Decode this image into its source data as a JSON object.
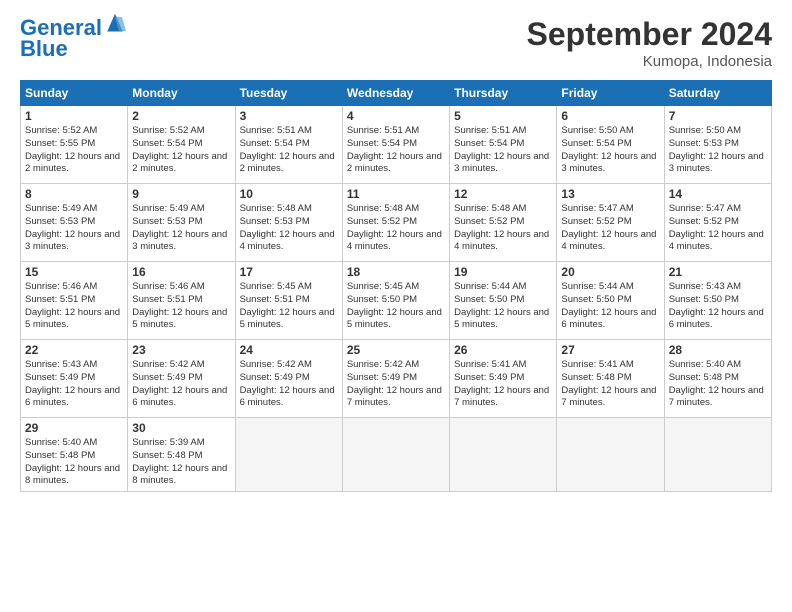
{
  "logo": {
    "line1": "General",
    "line2": "Blue"
  },
  "header": {
    "title": "September 2024",
    "subtitle": "Kumopa, Indonesia"
  },
  "days_of_week": [
    "Sunday",
    "Monday",
    "Tuesday",
    "Wednesday",
    "Thursday",
    "Friday",
    "Saturday"
  ],
  "weeks": [
    [
      {
        "day": "1",
        "sunrise": "5:52 AM",
        "sunset": "5:55 PM",
        "daylight": "12 hours and 2 minutes."
      },
      {
        "day": "2",
        "sunrise": "5:52 AM",
        "sunset": "5:54 PM",
        "daylight": "12 hours and 2 minutes."
      },
      {
        "day": "3",
        "sunrise": "5:51 AM",
        "sunset": "5:54 PM",
        "daylight": "12 hours and 2 minutes."
      },
      {
        "day": "4",
        "sunrise": "5:51 AM",
        "sunset": "5:54 PM",
        "daylight": "12 hours and 2 minutes."
      },
      {
        "day": "5",
        "sunrise": "5:51 AM",
        "sunset": "5:54 PM",
        "daylight": "12 hours and 3 minutes."
      },
      {
        "day": "6",
        "sunrise": "5:50 AM",
        "sunset": "5:54 PM",
        "daylight": "12 hours and 3 minutes."
      },
      {
        "day": "7",
        "sunrise": "5:50 AM",
        "sunset": "5:53 PM",
        "daylight": "12 hours and 3 minutes."
      }
    ],
    [
      {
        "day": "8",
        "sunrise": "5:49 AM",
        "sunset": "5:53 PM",
        "daylight": "12 hours and 3 minutes."
      },
      {
        "day": "9",
        "sunrise": "5:49 AM",
        "sunset": "5:53 PM",
        "daylight": "12 hours and 3 minutes."
      },
      {
        "day": "10",
        "sunrise": "5:48 AM",
        "sunset": "5:53 PM",
        "daylight": "12 hours and 4 minutes."
      },
      {
        "day": "11",
        "sunrise": "5:48 AM",
        "sunset": "5:52 PM",
        "daylight": "12 hours and 4 minutes."
      },
      {
        "day": "12",
        "sunrise": "5:48 AM",
        "sunset": "5:52 PM",
        "daylight": "12 hours and 4 minutes."
      },
      {
        "day": "13",
        "sunrise": "5:47 AM",
        "sunset": "5:52 PM",
        "daylight": "12 hours and 4 minutes."
      },
      {
        "day": "14",
        "sunrise": "5:47 AM",
        "sunset": "5:52 PM",
        "daylight": "12 hours and 4 minutes."
      }
    ],
    [
      {
        "day": "15",
        "sunrise": "5:46 AM",
        "sunset": "5:51 PM",
        "daylight": "12 hours and 5 minutes."
      },
      {
        "day": "16",
        "sunrise": "5:46 AM",
        "sunset": "5:51 PM",
        "daylight": "12 hours and 5 minutes."
      },
      {
        "day": "17",
        "sunrise": "5:45 AM",
        "sunset": "5:51 PM",
        "daylight": "12 hours and 5 minutes."
      },
      {
        "day": "18",
        "sunrise": "5:45 AM",
        "sunset": "5:50 PM",
        "daylight": "12 hours and 5 minutes."
      },
      {
        "day": "19",
        "sunrise": "5:44 AM",
        "sunset": "5:50 PM",
        "daylight": "12 hours and 5 minutes."
      },
      {
        "day": "20",
        "sunrise": "5:44 AM",
        "sunset": "5:50 PM",
        "daylight": "12 hours and 6 minutes."
      },
      {
        "day": "21",
        "sunrise": "5:43 AM",
        "sunset": "5:50 PM",
        "daylight": "12 hours and 6 minutes."
      }
    ],
    [
      {
        "day": "22",
        "sunrise": "5:43 AM",
        "sunset": "5:49 PM",
        "daylight": "12 hours and 6 minutes."
      },
      {
        "day": "23",
        "sunrise": "5:42 AM",
        "sunset": "5:49 PM",
        "daylight": "12 hours and 6 minutes."
      },
      {
        "day": "24",
        "sunrise": "5:42 AM",
        "sunset": "5:49 PM",
        "daylight": "12 hours and 6 minutes."
      },
      {
        "day": "25",
        "sunrise": "5:42 AM",
        "sunset": "5:49 PM",
        "daylight": "12 hours and 7 minutes."
      },
      {
        "day": "26",
        "sunrise": "5:41 AM",
        "sunset": "5:49 PM",
        "daylight": "12 hours and 7 minutes."
      },
      {
        "day": "27",
        "sunrise": "5:41 AM",
        "sunset": "5:48 PM",
        "daylight": "12 hours and 7 minutes."
      },
      {
        "day": "28",
        "sunrise": "5:40 AM",
        "sunset": "5:48 PM",
        "daylight": "12 hours and 7 minutes."
      }
    ],
    [
      {
        "day": "29",
        "sunrise": "5:40 AM",
        "sunset": "5:48 PM",
        "daylight": "12 hours and 8 minutes."
      },
      {
        "day": "30",
        "sunrise": "5:39 AM",
        "sunset": "5:48 PM",
        "daylight": "12 hours and 8 minutes."
      },
      null,
      null,
      null,
      null,
      null
    ]
  ]
}
